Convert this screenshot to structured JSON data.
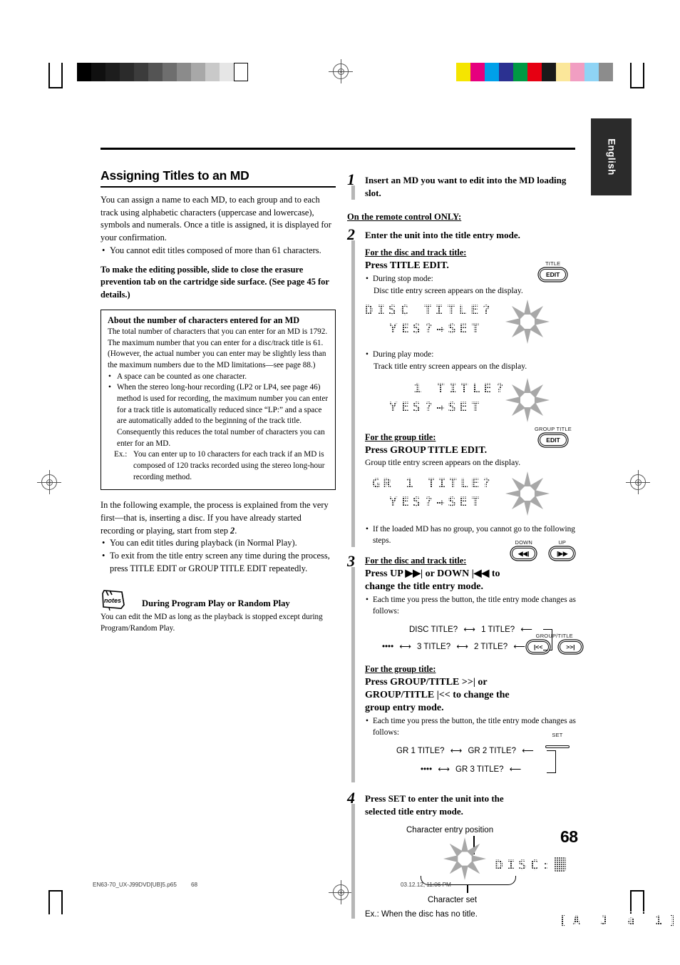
{
  "print_marks": {
    "gray_wedge": [
      "#000000",
      "#101010",
      "#1d1d1d",
      "#2b2b2b",
      "#3c3c3c",
      "#545454",
      "#6e6e6e",
      "#8b8b8b",
      "#a8a8a8",
      "#c9c9c9",
      "#e6e6e6",
      "#ffffff"
    ],
    "color_bars": [
      "#f5e500",
      "#e6007e",
      "#00a0e9",
      "#2b3191",
      "#009944",
      "#e60012",
      "#1a1a1a",
      "#fbe79a",
      "#f19ec2",
      "#8fd4f5",
      "#8c8c8c"
    ]
  },
  "page": {
    "language_tab": "English",
    "page_number": "68"
  },
  "left_column": {
    "title": "Assigning Titles to an MD",
    "intro": "You can assign a name to each MD, to each group and to each track using alphabetic characters (uppercase and lowercase), symbols and numerals. Once a title is assigned, it is displayed for your confirmation.",
    "intro_bullet": "You cannot edit titles composed of more than 61 characters.",
    "erasure_note": "To make the editing possible, slide to close the erasure prevention tab on the cartridge side surface. (See page 45 for details.)",
    "box": {
      "heading": "About the number of characters entered for an MD",
      "body": "The total number of characters that you can enter for an MD is 1792. The maximum number that you can enter for a disc/track title is 61. (However, the actual number you can enter may be slightly less than the maximum numbers due to the MD limitations—see page 88.)",
      "bullet1": "A space can be counted as one character.",
      "bullet2": "When the stereo long-hour recording (LP2 or LP4, see page 46) method is used for recording, the maximum number you can enter for a track title is automatically reduced since “LP:” and a space are automatically added to the beginning of the track title. Consequently this reduces the total number of characters you can enter for an MD.",
      "example_label": "Ex.:",
      "example_text": "You can enter up to 10 characters for each track if an MD is composed of 120 tracks recorded using the stereo long-hour recording method."
    },
    "example_intro_a": "In the following example, the process is explained from the very first—that is, inserting a disc. If you have already started recording or playing, start from step ",
    "example_intro_step": "2",
    "example_intro_b": ".",
    "bullet_playback": "You can edit titles during playback (in Normal Play).",
    "bullet_exit": "To exit from the title entry screen any time during the process, press TITLE EDIT or GROUP TITLE EDIT repeatedly.",
    "notes": {
      "icon_label": "notes",
      "heading": "During Program Play or Random Play",
      "body": "You can edit the MD as long as the playback is stopped except during Program/Random Play."
    }
  },
  "right_column": {
    "step1": {
      "number": "1",
      "text": "Insert an MD you want to edit into the MD loading slot."
    },
    "remote_only_label": "On the remote control ONLY:",
    "step2": {
      "number": "2",
      "text": "Enter the unit into the title entry mode.",
      "disc_track_label": "For the disc and track title:",
      "press_title_edit": "Press TITLE EDIT.",
      "key_title_edit": {
        "cap": "TITLE",
        "label": "EDIT"
      },
      "stop_mode_bullet": "During stop mode:",
      "stop_mode_text": "Disc title entry screen appears on the display.",
      "lcd_disc": {
        "line1": "DISC TITLE?",
        "line2": "YES?→SET"
      },
      "play_mode_bullet": "During play mode:",
      "play_mode_text": "Track title entry screen appears on the display.",
      "lcd_track": {
        "line1": "1 TITLE?",
        "line2": "YES?→SET"
      },
      "group_label": "For the group title:",
      "press_group_title_edit": "Press GROUP TITLE EDIT.",
      "key_group_title_edit": {
        "cap": "GROUP TITLE",
        "label": "EDIT"
      },
      "group_text": "Group title entry screen appears on the display.",
      "lcd_group": {
        "line1": "GR 1 TITLE?",
        "line2": "YES?→SET"
      },
      "no_group_bullet": "If the loaded MD has no group, you cannot go to the following steps."
    },
    "step3": {
      "number": "3",
      "disc_track_label": "For the disc and track title:",
      "press_updown": "Press UP ▶▶| or DOWN |◀◀ to change the title entry mode.",
      "key_down": {
        "cap": "DOWN",
        "label": "◀◀|"
      },
      "key_up": {
        "cap": "UP",
        "label": "|▶▶"
      },
      "each_time": "Each time you press the button, the title entry mode changes as follows:",
      "flow_track": {
        "row1": [
          "DISC TITLE?",
          "1 TITLE?"
        ],
        "row2": [
          "••••",
          "3 TITLE?",
          "2 TITLE?"
        ]
      },
      "group_label": "For the group title:",
      "press_group": "Press GROUP/TITLE >>| or GROUP/TITLE |<< to change the group entry mode.",
      "key_group_pair_cap": "GROUP/TITLE",
      "key_group_prev": "|<<",
      "key_group_next": ">>|",
      "each_time_group": "Each time you press the button, the title entry mode changes as follows:",
      "flow_group": {
        "row1": [
          "GR 1 TITLE?",
          "GR 2 TITLE?"
        ],
        "row2": [
          "••••",
          "GR 3 TITLE?"
        ]
      }
    },
    "step4": {
      "number": "4",
      "text": "Press SET to enter the unit into the selected title entry mode.",
      "key_set": {
        "cap": "SET",
        "label": ""
      },
      "callout_top": "Character entry position",
      "callout_bottom": "Character set",
      "lcd": {
        "line1": "DISC:",
        "line2": "[A J a 1]"
      },
      "example": "Ex.: When the disc has no title."
    }
  },
  "footer": {
    "filename": "EN63-70_UX-J99DVD[UB]5.p65",
    "page": "68",
    "timestamp": "03.12.12, 11:06 PM"
  }
}
